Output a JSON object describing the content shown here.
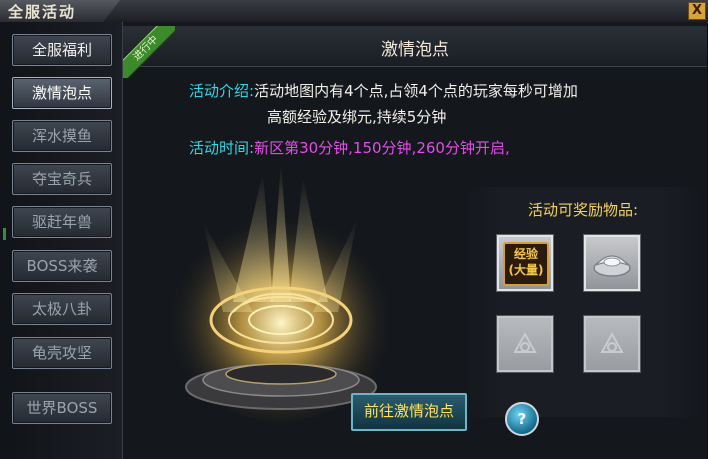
{
  "window": {
    "title": "全服活动",
    "close_label": "X"
  },
  "sidebar": {
    "items": [
      {
        "label": "全服福利",
        "state": "normal"
      },
      {
        "label": "激情泡点",
        "state": "active"
      },
      {
        "label": "浑水摸鱼",
        "state": "disabled"
      },
      {
        "label": "夺宝奇兵",
        "state": "disabled"
      },
      {
        "label": "驱赶年兽",
        "state": "disabled"
      },
      {
        "label": "BOSS来袭",
        "state": "disabled"
      },
      {
        "label": "太极八卦",
        "state": "disabled"
      },
      {
        "label": "龟壳攻坚",
        "state": "disabled"
      },
      {
        "label": "世界BOSS",
        "state": "disabled"
      }
    ],
    "side_marker": "1"
  },
  "main": {
    "title": "激情泡点",
    "status_ribbon": "进行中",
    "intro_label": "活动介绍:",
    "intro_line1": "活动地图内有4个点,占领4个点的玩家每秒可增加",
    "intro_line2": "高额经验及绑元,持续5分钟",
    "time_label": "活动时间:",
    "time_value": "新区第30分钟,150分钟,260分钟开启,",
    "reward_title": "活动可奖励物品:",
    "rewards": [
      {
        "icon": "exp-scroll-icon",
        "text": "经验\n(大量)"
      },
      {
        "icon": "silver-ingot-icon"
      },
      {
        "icon": "empty-slot-icon"
      },
      {
        "icon": "empty-slot-icon"
      }
    ],
    "goto_label": "前往激情泡点",
    "help_label": "?"
  },
  "colors": {
    "label_cyan": "#35d6e6",
    "time_magenta": "#e44ce8",
    "reward_gold": "#f4d25a",
    "goto_yellow": "#ffe25a",
    "ribbon_green": "#3d8a2c"
  }
}
